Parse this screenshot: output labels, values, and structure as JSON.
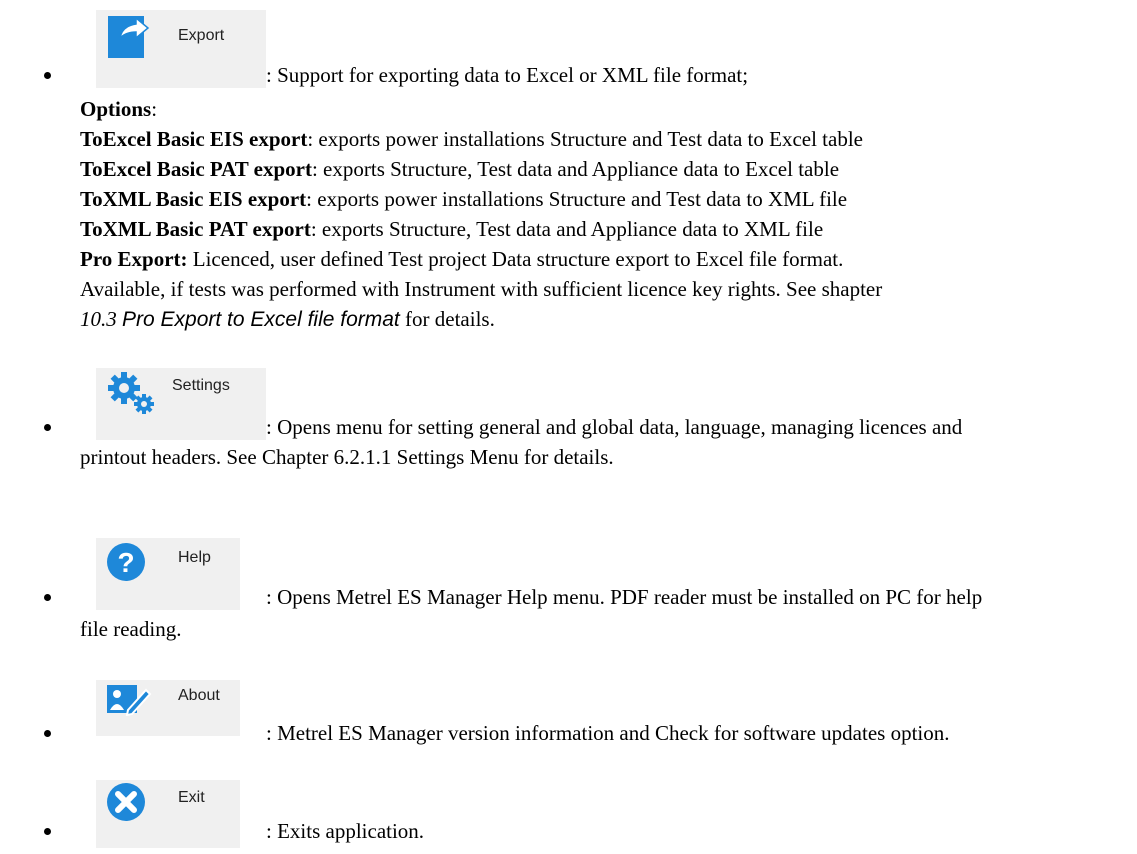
{
  "export": {
    "button_label": "Export",
    "description": ": Support for exporting data to Excel or XML file format;",
    "options_heading": "Options",
    "options_colon": ":",
    "options": [
      {
        "name": "ToExcel Basic EIS export",
        "text": ": exports power installations Structure and Test data to Excel table"
      },
      {
        "name": "ToExcel Basic PAT export",
        "text": ": exports Structure, Test data and Appliance data to Excel table"
      },
      {
        "name": "ToXML Basic EIS export",
        "text": ": exports power installations Structure and Test data to XML file"
      },
      {
        "name": "ToXML Basic PAT export",
        "text": ": exports Structure, Test data and Appliance data to XML file"
      }
    ],
    "pro": {
      "name": "Pro Export:",
      "line1": " Licenced, user defined Test project Data structure export to Excel file format.",
      "line2": "Available, if tests was performed with Instrument with sufficient licence key rights. See shapter",
      "ref_num": "10.3 ",
      "ref_title": "Pro Export to Excel file format",
      "ref_tail": " for details."
    }
  },
  "settings": {
    "button_label": "Settings",
    "desc_line1": ": Opens menu for setting general and global data, language, managing licences and",
    "desc_line2": "printout headers. See Chapter 6.2.1.1 Settings Menu for details."
  },
  "help": {
    "button_label": "Help",
    "desc_line1": ": Opens Metrel ES Manager Help menu. PDF reader must be installed on PC for help",
    "desc_line2": "file reading."
  },
  "about": {
    "button_label": "About",
    "description": ": Metrel ES Manager version information and Check for software updates option."
  },
  "exit": {
    "button_label": "Exit",
    "description": ": Exits application."
  },
  "colors": {
    "icon_blue": "#1e88d9",
    "button_bg": "#f0f0f0"
  },
  "icons": [
    "export-icon",
    "settings-icon",
    "help-icon",
    "about-icon",
    "exit-icon"
  ]
}
